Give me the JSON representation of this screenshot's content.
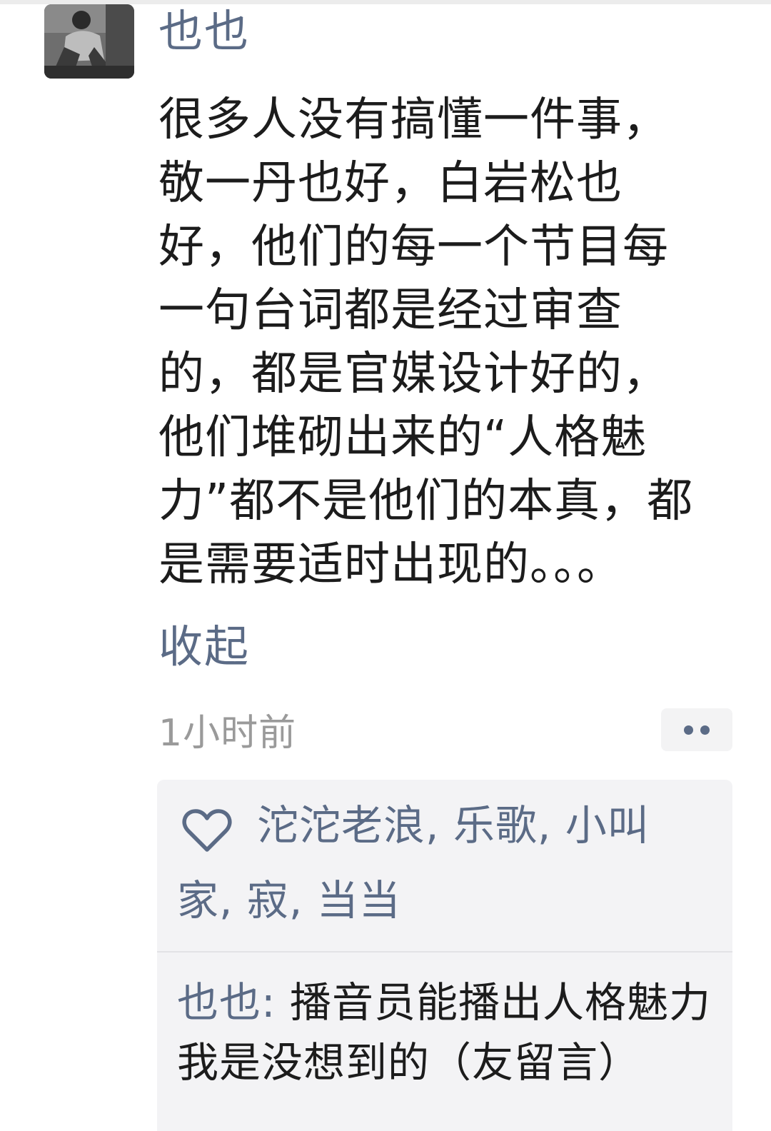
{
  "post": {
    "username": "也也",
    "body_lines": [
      "很多人没有搞懂一件事，",
      "敬一丹也好，白岩松也",
      "好，他们的每一个节目每",
      "一句台词都是经过审查",
      "的，都是官媒设计好的，",
      "他们堆砌出来的“人格魅",
      "力”都不是他们的本真，都",
      "是需要适时出现的。。。"
    ],
    "collapse_label": "收起",
    "timestamp": "1小时前"
  },
  "likes": {
    "icon": "heart-icon",
    "names": "沱沱老浪, 乐歌, 小叫家, 寂, 当当"
  },
  "comments": [
    {
      "author": "也也",
      "separator": ": ",
      "text_line1": "播音员能播出人格魅力",
      "text_line2": "我是没想到的（友留言）"
    }
  ],
  "colors": {
    "link": "#5b6b86",
    "timestamp": "#9a9a9a",
    "panel_bg": "#f3f3f5"
  }
}
